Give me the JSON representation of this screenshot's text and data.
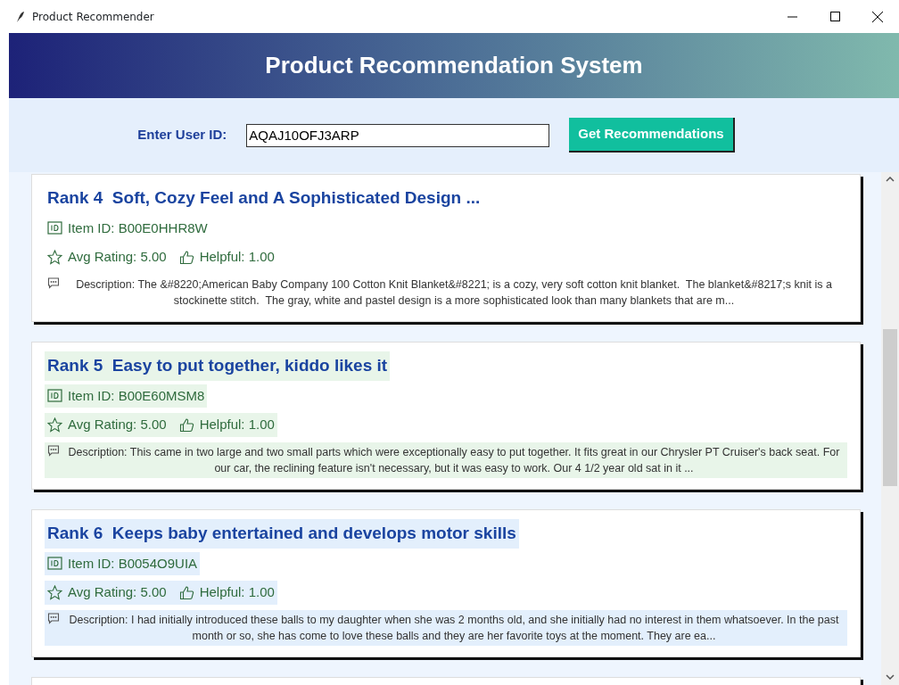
{
  "window": {
    "title": "Product Recommender"
  },
  "header": {
    "title": "Product Recommendation System"
  },
  "user_input": {
    "label": "Enter User ID:",
    "value": "AQAJ10OFJ3ARP"
  },
  "button": {
    "label": "Get Recommendations"
  },
  "cards": [
    {
      "title": "Rank 4  Soft, Cozy Feel and A Sophisticated Design ...",
      "item_id": "Item ID: B00E0HHR8W",
      "rating": "Avg Rating: 5.00",
      "helpful": "Helpful: 1.00",
      "description": "Description: The &#8220;American Baby Company 100 Cotton Knit Blanket&#8221; is a cozy, very soft cotton knit blanket.  The blanket&#8217;s knit is a stockinette stitch.  The gray, white and pastel design is a more sophisticated look than many blankets that are m...",
      "color": "#ffffff"
    },
    {
      "title": "Rank 5  Easy to put together, kiddo likes it",
      "item_id": "Item ID: B00E60MSM8",
      "rating": "Avg Rating: 5.00",
      "helpful": "Helpful: 1.00",
      "description": "Description: This came in two large and two small parts which were exceptionally easy to put together. It fits great in our Chrysler PT Cruiser's back seat. For our car, the reclining feature isn't necessary, but it was easy to work. Our 4 1/2 year old sat in it ...",
      "color": "#e8f5e9"
    },
    {
      "title": "Rank 6  Keeps baby entertained and develops motor skills",
      "item_id": "Item ID: B0054O9UIA",
      "rating": "Avg Rating: 5.00",
      "helpful": "Helpful: 1.00",
      "description": "Description: I had initially introduced these balls to my daughter when she was 2 months old, and she initially had no interest in them whatsoever. In the past month or so, she has come to love these balls and they are her favorite toys at the moment. They are ea...",
      "color": "#e3effc"
    }
  ]
}
